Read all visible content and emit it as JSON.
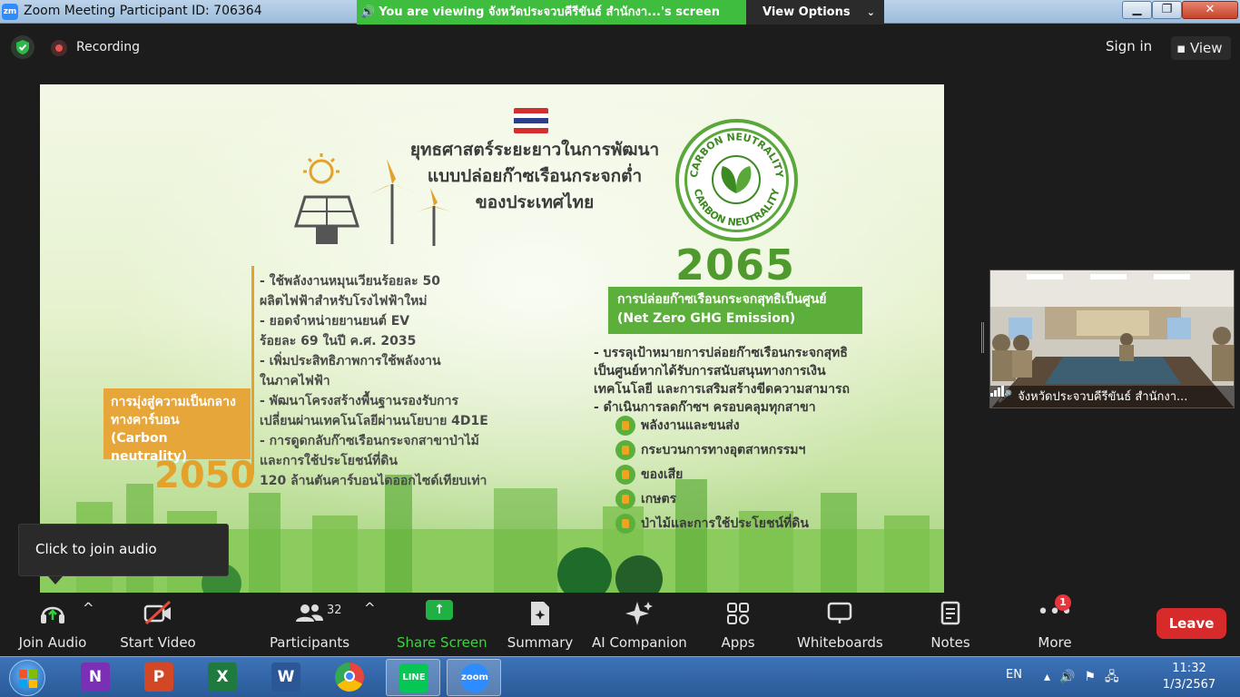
{
  "window": {
    "title": "Zoom Meeting Participant ID: 706364",
    "logo": "zm",
    "min": "▁",
    "max": "❐",
    "close": "✕"
  },
  "banner": {
    "text": "You are viewing จังหวัดประจวบคีรีขันธ์ สำนักงา...'s screen",
    "view_options": "View Options"
  },
  "topbar": {
    "recording": "Recording",
    "sign_in": "Sign in",
    "view": "View"
  },
  "slide": {
    "title_lines": [
      "ยุทธศาสตร์ระยะยาวในการพัฒนา",
      "แบบปล่อยก๊าซเรือนกระจกต่ำ",
      "ของประเทศไทย"
    ],
    "badge_text": "CARBON NEUTRALITY",
    "year_right": "2065",
    "net_zero_th": "การปล่อยก๊าซเรือนกระจกสุทธิเป็นศูนย์",
    "net_zero_en": "(Net Zero GHG Emission)",
    "right_bullets": [
      "- บรรลุเป้าหมายการปล่อยก๊าซเรือนกระจกสุทธิ",
      "  เป็นศูนย์หากได้รับการสนับสนุนทางการเงิน",
      "  เทคโนโลยี และการเสริมสร้างขีดความสามารถ",
      "- ดำเนินการลดก๊าซฯ ครอบคลุมทุกสาขา"
    ],
    "sectors": [
      "พลังงานและขนส่ง",
      "กระบวนการทางอุตสาหกรรมฯ",
      "ของเสีย",
      "เกษตร",
      "ป่าไม้และการใช้ประโยชน์ที่ดิน"
    ],
    "left_bullets": [
      "- ใช้พลังงานหมุนเวียนร้อยละ 50",
      "  ผลิตไฟฟ้าสำหรับโรงไฟฟ้าใหม่",
      "- ยอดจำหน่ายยานยนต์ EV",
      "  ร้อยละ 69 ในปี ค.ศ. 2035",
      "- เพิ่มประสิทธิภาพการใช้พลังงาน",
      "  ในภาคไฟฟ้า",
      "- พัฒนาโครงสร้างพื้นฐานรองรับการ",
      "  เปลี่ยนผ่านเทคโนโลยีผ่านนโยบาย 4D1E",
      "- การดูดกลับก๊าซเรือนกระจกสาขาป่าไม้",
      "  และการใช้ประโยชน์ที่ดิน",
      "  120 ล้านตันคาร์บอนไดออกไซด์เทียบเท่า"
    ],
    "cn_box": [
      "การมุ่งสู่ความเป็นกลาง",
      "ทางคาร์บอน",
      "(Carbon neutrality)"
    ],
    "year_left": "2050"
  },
  "participant": {
    "name": "จังหวัดประจวบคีรีขันธ์ สำนักงา..."
  },
  "tooltip": "Click to join audio",
  "toolbar": {
    "join_audio": "Join Audio",
    "start_video": "Start Video",
    "participants": "Participants",
    "participants_count": "32",
    "share_screen": "Share Screen",
    "summary": "Summary",
    "ai_companion": "AI Companion",
    "apps": "Apps",
    "whiteboards": "Whiteboards",
    "notes": "Notes",
    "more": "More",
    "more_badge": "1",
    "leave": "Leave"
  },
  "taskbar": {
    "apps": [
      {
        "name": "onenote",
        "letter": "N",
        "color": "#7b2fb5"
      },
      {
        "name": "powerpoint",
        "letter": "P",
        "color": "#d24726"
      },
      {
        "name": "excel",
        "letter": "X",
        "color": "#1f7a3f"
      },
      {
        "name": "word",
        "letter": "W",
        "color": "#2b5797"
      },
      {
        "name": "chrome",
        "letter": "",
        "color": "#e8453c"
      },
      {
        "name": "line",
        "letter": "LINE",
        "color": "#06c755"
      },
      {
        "name": "zoom",
        "letter": "zoom",
        "color": "#2d8cff"
      }
    ],
    "lang": "EN",
    "time": "11:32",
    "date": "1/3/2567"
  }
}
